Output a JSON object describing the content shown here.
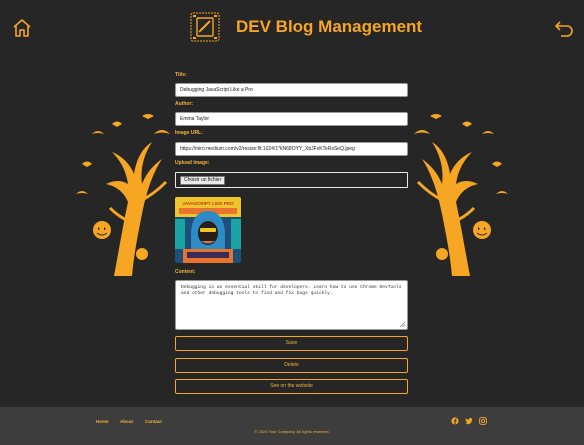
{
  "header": {
    "title": "DEV Blog Management",
    "home_icon": "home-icon",
    "back_icon": "back-arrow-icon",
    "logo_icon": "code-book-logo-icon"
  },
  "form": {
    "title_label": "Title:",
    "title_value": "Debugging JavaScript Like a Pro",
    "author_label": "Author:",
    "author_value": "Emma Taylor",
    "image_url_label": "Image URL:",
    "image_url_value": "https://miro.medium.com/v2/resize:fit:1024/1*kN68OYY_XbJFvKTeRsSeQ.jpeg",
    "upload_label": "Upload Image:",
    "file_button_label": "Choisir un fichier",
    "content_label": "Content:",
    "content_value": "Debugging is an essential skill for developers. Learn how to use Chrome DevTools and other debugging tools to find and fix bugs quickly.",
    "preview_caption": "JAVASCRIPT LIKE PRO"
  },
  "buttons": {
    "save": "Save",
    "delete": "Delete",
    "see_website": "See on the website"
  },
  "footer": {
    "links": [
      "Home",
      "About",
      "Contact"
    ],
    "social_icons": [
      "facebook-icon",
      "twitter-icon",
      "instagram-icon"
    ],
    "copyright": "© 2024 Your Company. All rights reserved."
  },
  "colors": {
    "accent": "#f6a623",
    "background": "#262626",
    "footer": "#3d3d3d"
  }
}
